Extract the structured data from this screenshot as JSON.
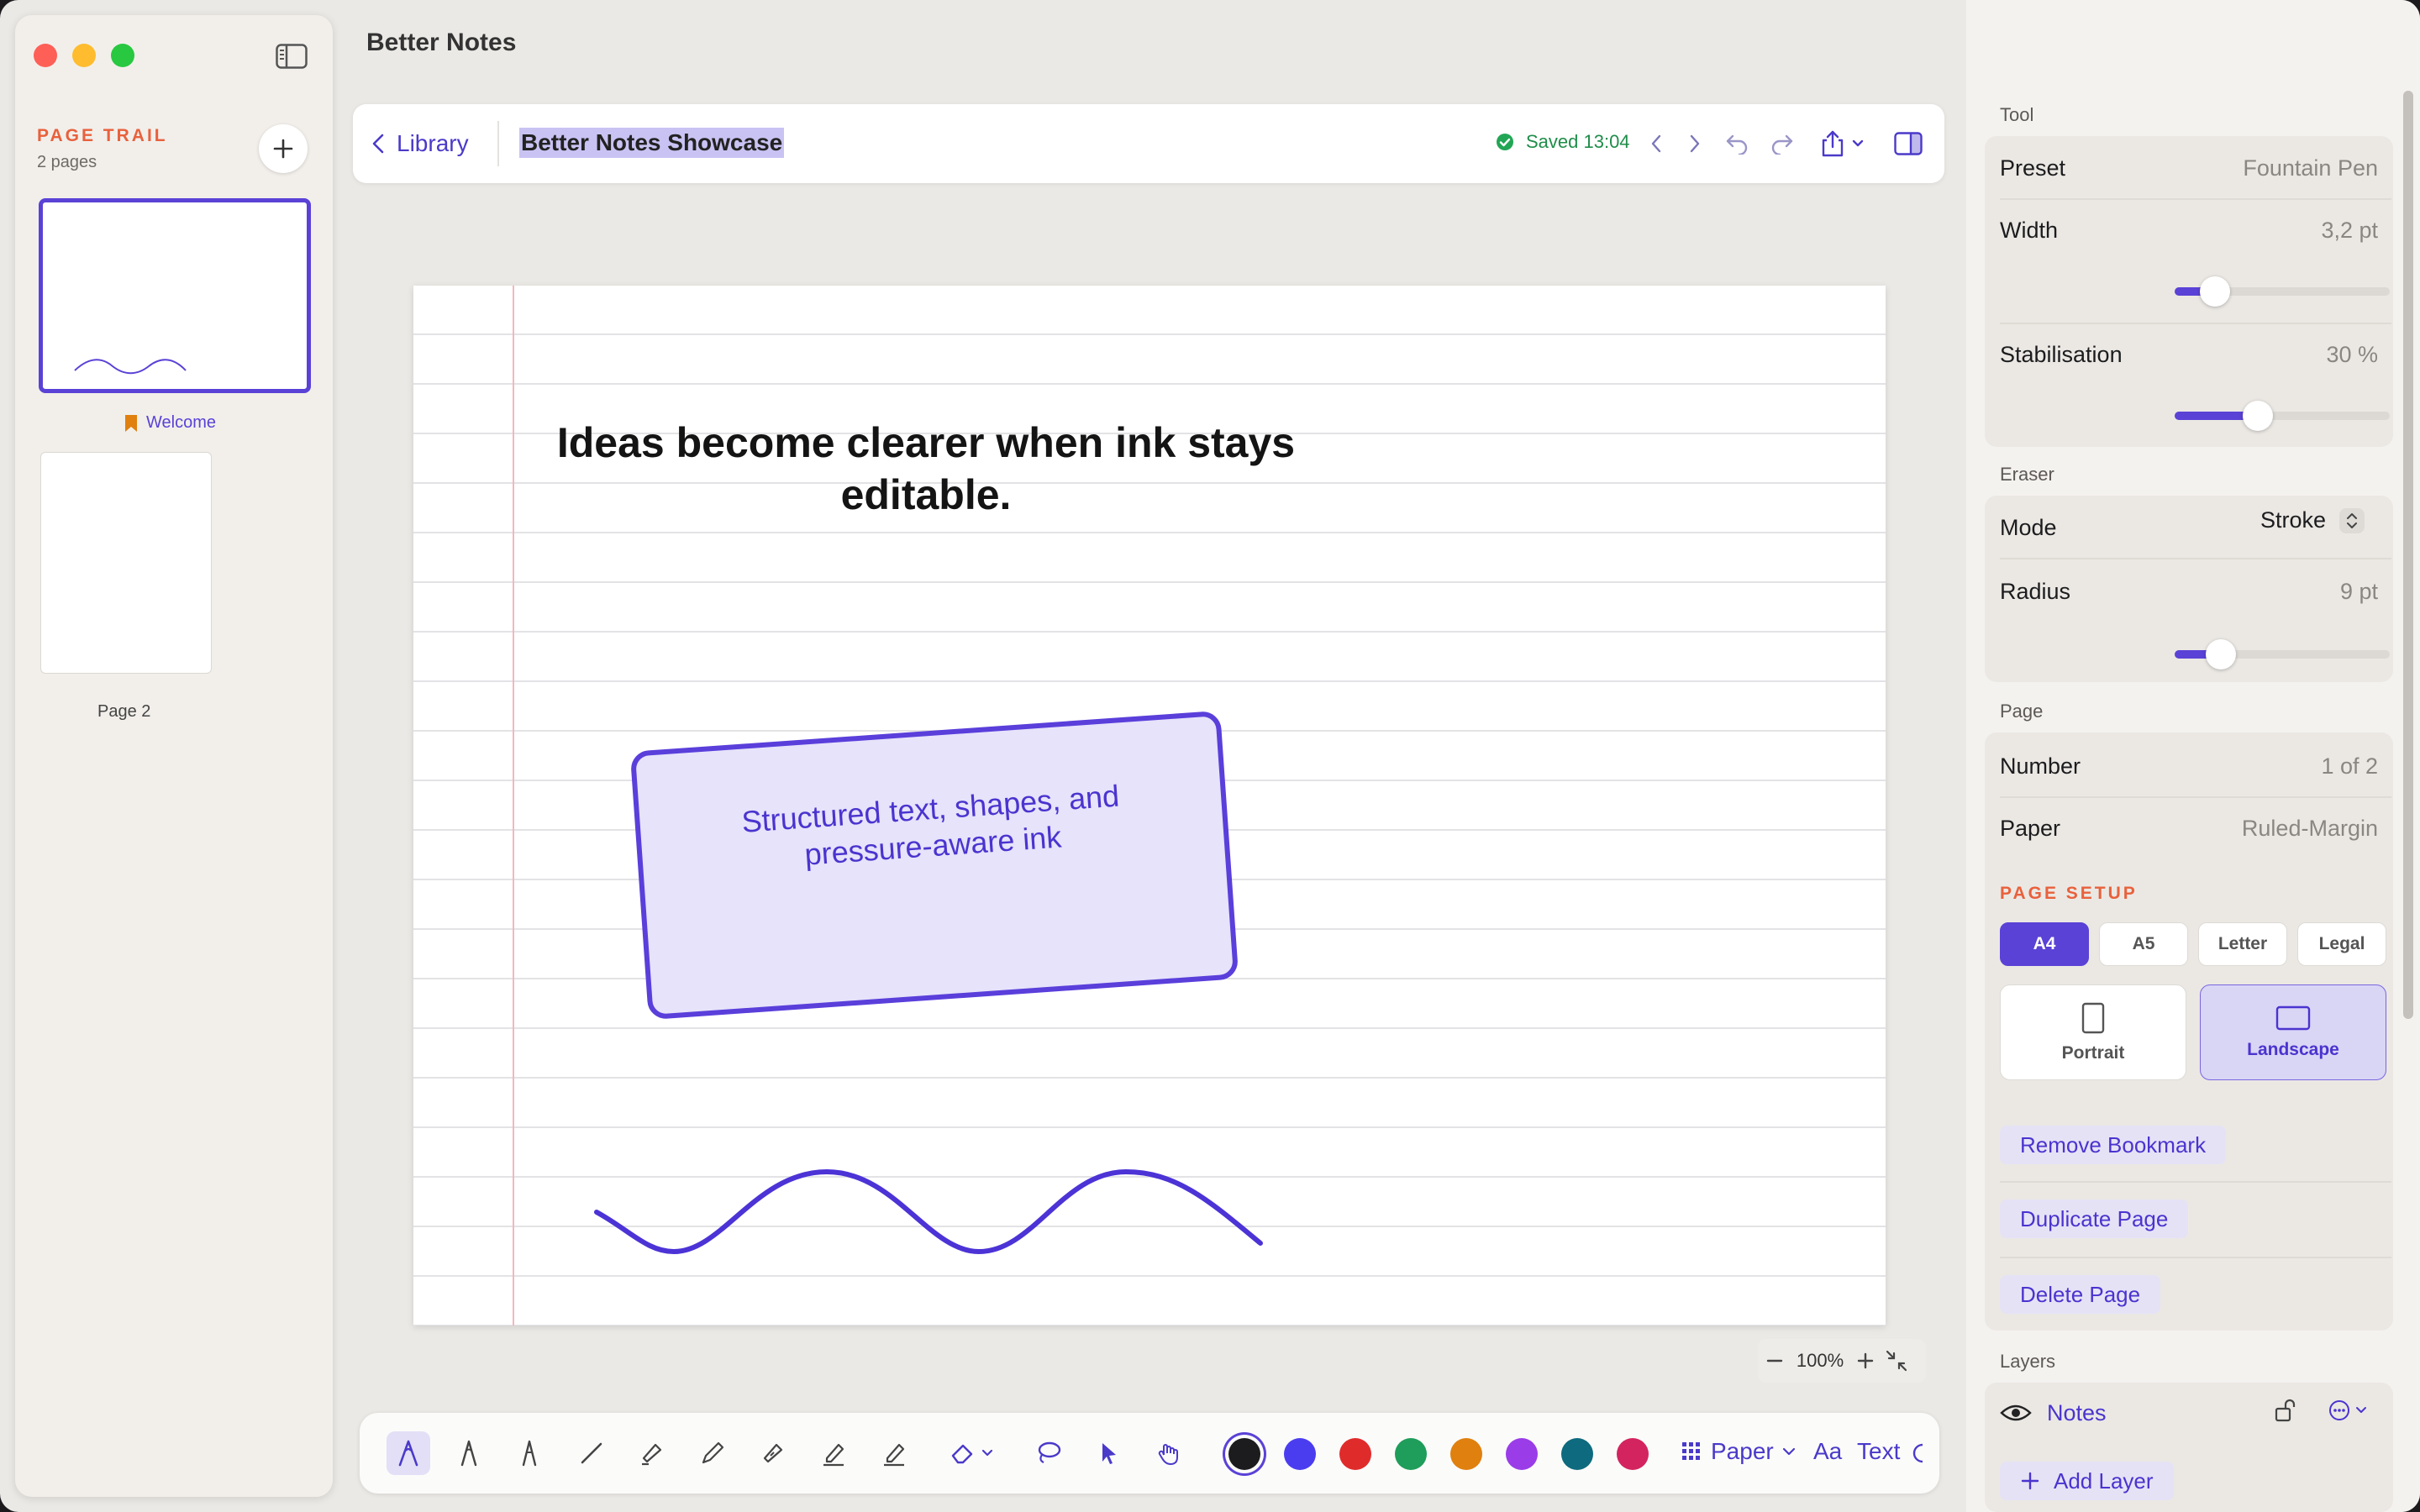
{
  "app": {
    "title": "Better Notes"
  },
  "sidebar": {
    "section_title": "PAGE TRAIL",
    "page_count": "2 pages",
    "pages": [
      {
        "label": "Welcome",
        "bookmarked": true,
        "selected": true
      },
      {
        "label": "Page 2",
        "bookmarked": false,
        "selected": false
      }
    ]
  },
  "topbar": {
    "back_label": "Library",
    "document_title": "Better Notes Showcase",
    "saved_status": "Saved 13:04"
  },
  "canvas": {
    "headline": "Ideas become clearer when ink stays editable.",
    "card_text": "Structured text, shapes, and pressure-aware ink",
    "zoom": "100%"
  },
  "toolbar": {
    "colors": [
      "#1c1c1e",
      "#4a3df0",
      "#e02b2b",
      "#1f9d5a",
      "#e0800e",
      "#9a3ce8",
      "#0e6a7e",
      "#d3245f"
    ],
    "selected_color": "#1c1c1e",
    "paper_label": "Paper",
    "font_label": "Aa",
    "text_label": "Text"
  },
  "inspector": {
    "tool": {
      "section": "Tool",
      "preset_label": "Preset",
      "preset_value": "Fountain Pen",
      "width_label": "Width",
      "width_value": "3,2 pt",
      "width_level": 0.1,
      "stab_label": "Stabilisation",
      "stab_value": "30 %",
      "stab_level": 0.3
    },
    "eraser": {
      "section": "Eraser",
      "mode_label": "Mode",
      "mode_value": "Stroke",
      "radius_label": "Radius",
      "radius_value": "9 pt",
      "radius_level": 0.13
    },
    "page": {
      "section": "Page",
      "number_label": "Number",
      "number_value": "1 of 2",
      "paper_label": "Paper",
      "paper_value": "Ruled-Margin"
    },
    "setup": {
      "title": "PAGE SETUP",
      "sizes": [
        "A4",
        "A5",
        "Letter",
        "Legal"
      ],
      "selected_size": "A4",
      "portrait": "Portrait",
      "landscape": "Landscape",
      "selected_orientation": "Landscape"
    },
    "actions": {
      "remove_bookmark": "Remove Bookmark",
      "duplicate_page": "Duplicate Page",
      "delete_page": "Delete Page"
    },
    "layers": {
      "section": "Layers",
      "items": [
        {
          "name": "Notes",
          "visible": true,
          "locked": false
        }
      ],
      "add_label": "Add Layer"
    }
  },
  "accent_color": "#5a42d6",
  "highlight_color": "#e8613c"
}
